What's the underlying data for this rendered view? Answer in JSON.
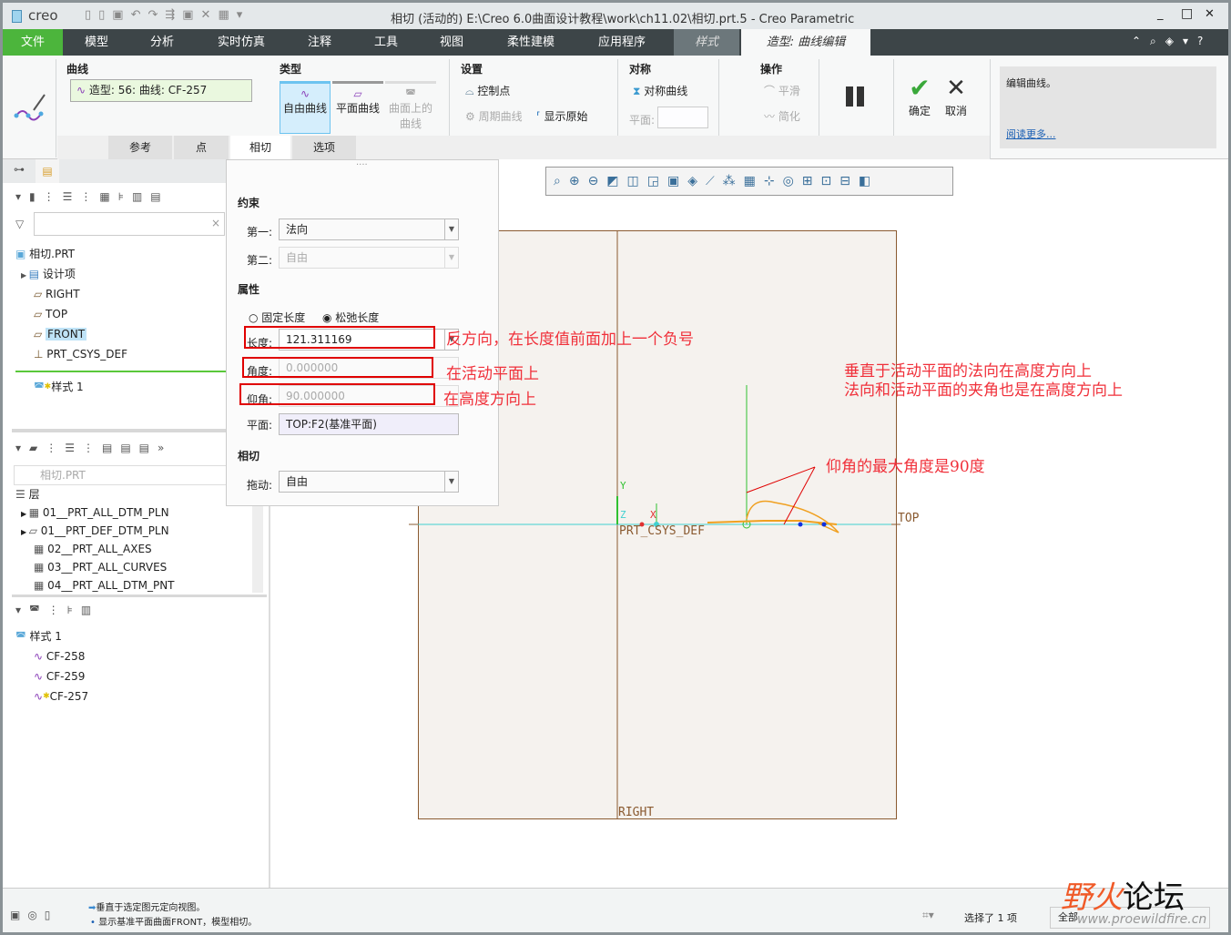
{
  "titlebar": {
    "logo": "creo",
    "title": "相切 (活动的) E:\\Creo 6.0曲面设计教程\\work\\ch11.02\\相切.prt.5 - Creo Parametric",
    "minimize": "_",
    "maximize": "□",
    "close": "✕"
  },
  "menu": {
    "items": [
      "文件",
      "模型",
      "分析",
      "实时仿真",
      "注释",
      "工具",
      "视图",
      "柔性建模",
      "应用程序",
      "样式",
      "造型: 曲线编辑"
    ]
  },
  "ribbon": {
    "curve_group": "曲线",
    "curve_value": "造型: 56: 曲线: CF-257",
    "type_group": "类型",
    "type_free": "自由曲线",
    "type_planar": "平面曲线",
    "type_on_surface": "曲面上的曲线",
    "settings_group": "设置",
    "control_points": "控制点",
    "periodic": "周期曲线",
    "show_original": "显示原始",
    "symmetry_group": "对称",
    "symmetric_curve": "对称曲线",
    "plane_label": "平面:",
    "ops_group": "操作",
    "smooth": "平滑",
    "simplify": "简化",
    "ok": "确定",
    "cancel": "取消",
    "help_text": "编辑曲线。",
    "read_more": "阅读更多...",
    "tabs": [
      "参考",
      "点",
      "相切",
      "选项"
    ]
  },
  "tangent_panel": {
    "constraint_title": "约束",
    "first_label": "第一:",
    "first_value": "法向",
    "second_label": "第二:",
    "second_value": "自由",
    "props_title": "属性",
    "fixed_length": "固定长度",
    "relaxed_length": "松弛长度",
    "length_label": "长度:",
    "length_value": "121.311169",
    "angle_label": "角度:",
    "angle_value": "0.000000",
    "elev_label": "仰角:",
    "elev_value": "90.000000",
    "plane_label": "平面:",
    "plane_value": "TOP:F2(基准平面)",
    "tangent_title": "相切",
    "drag_label": "拖动:",
    "drag_value": "自由"
  },
  "model_tree": {
    "items": [
      "相切.PRT",
      "设计项",
      "RIGHT",
      "TOP",
      "FRONT",
      "PRT_CSYS_DEF",
      "样式 1"
    ]
  },
  "layer_tree": {
    "root": "相切.PRT",
    "layers_label": "层",
    "items": [
      "01__PRT_ALL_DTM_PLN",
      "01__PRT_DEF_DTM_PLN",
      "02__PRT_ALL_AXES",
      "03__PRT_ALL_CURVES",
      "04__PRT_ALL_DTM_PNT"
    ]
  },
  "style_tree": {
    "root": "样式 1",
    "items": [
      "CF-258",
      "CF-259",
      "CF-257"
    ]
  },
  "viewport": {
    "labels": {
      "top": "TOP",
      "right": "RIGHT",
      "csys": "PRT_CSYS_DEF",
      "y": "Y",
      "z": "Z",
      "x": "X"
    },
    "annotations": [
      "反方向，在长度值前面加上一个负号",
      "在活动平面上",
      "在高度方向上",
      "垂直于活动平面的法向在高度方向上",
      "法向和活动平面的夹角也是在高度方向上",
      "仰角的最大角度是90度"
    ]
  },
  "statusbar": {
    "msg1": "垂直于选定图元定向视图。",
    "msg2": "显示基准平面曲面FRONT，模型相切。",
    "selected": "选择了 1 项",
    "filter": "全部"
  },
  "watermark": {
    "text": "野火论坛",
    "url": "www.proewildfire.cn"
  },
  "colors": {
    "menu_bg": "#3d4548",
    "file_tab": "#4cb53c",
    "annotation": "#f0303a",
    "curve": "#f0a020",
    "highlight": "#bfe3f7"
  }
}
